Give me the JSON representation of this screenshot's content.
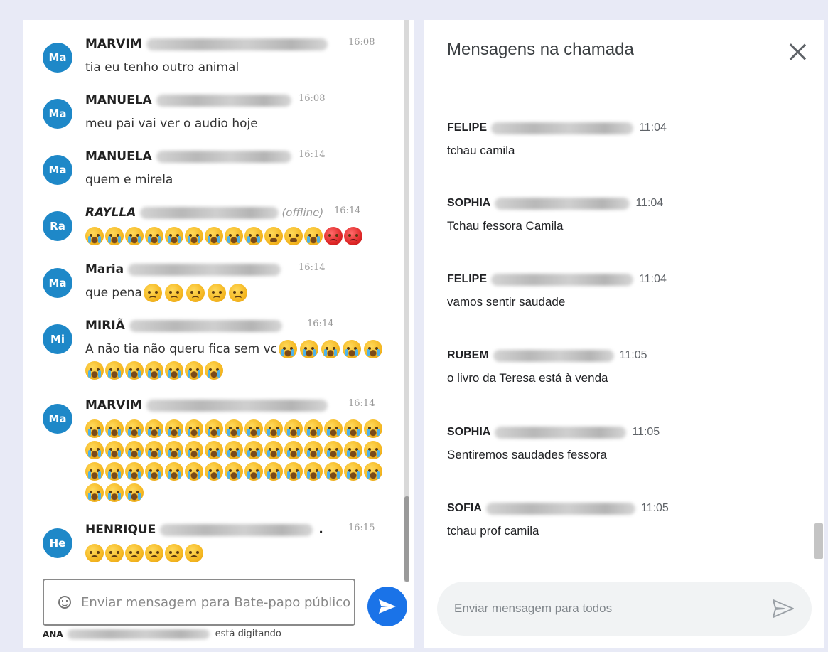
{
  "public_chat": {
    "messages": [
      {
        "initials": "Ma",
        "sender": "MARVIM",
        "time": "16:08",
        "text": "tia eu tenho outro animal",
        "emojis": []
      },
      {
        "initials": "Ma",
        "sender": "MANUELA",
        "time": "16:08",
        "text": "meu pai vai ver o audio hoje",
        "emojis": []
      },
      {
        "initials": "Ma",
        "sender": "MANUELA",
        "time": "16:14",
        "text": "quem e mirela",
        "emojis": []
      },
      {
        "initials": "Ra",
        "sender": "RAYLLA",
        "status": "(offline)",
        "time": "16:14",
        "text": "",
        "emojis": [
          "cry",
          "cry",
          "cry",
          "cry",
          "cry",
          "cry",
          "cry",
          "cry",
          "cry",
          "tired",
          "tired",
          "cry",
          "angry",
          "angry"
        ]
      },
      {
        "initials": "Ma",
        "sender": "Maria",
        "time": "16:14",
        "text": "que pena",
        "emojis": [
          "sad",
          "sad",
          "sad",
          "sad",
          "sad"
        ]
      },
      {
        "initials": "Mi",
        "sender": "MIRIÃ",
        "time": "16:14",
        "text": "A não tia não queru fica sem vc",
        "emojis": [
          "cry",
          "cry",
          "cry",
          "cry",
          "cry",
          "cry",
          "cry",
          "cry",
          "cry",
          "cry",
          "cry",
          "cry"
        ]
      },
      {
        "initials": "Ma",
        "sender": "MARVIM",
        "time": "16:14",
        "text": "",
        "emoji_count": 48
      },
      {
        "initials": "He",
        "sender": "HENRIQUE",
        "time": "16:15",
        "text": "",
        "emojis": [
          "worried",
          "worried",
          "worried",
          "worried",
          "worried",
          "worried"
        ]
      }
    ],
    "compose_placeholder": "Enviar mensagem para Bate-papo público",
    "typing_name": "ANA",
    "typing_label": "está digitando"
  },
  "meeting_chat": {
    "title": "Mensagens na chamada",
    "messages": [
      {
        "sender": "FELIPE",
        "time": "11:04",
        "text": "tchau camila"
      },
      {
        "sender": "SOPHIA",
        "time": "11:04",
        "text": "Tchau fessora Camila"
      },
      {
        "sender": "FELIPE",
        "time": "11:04",
        "text": "vamos sentir saudade"
      },
      {
        "sender": "RUBEM",
        "time": "11:05",
        "text": "o livro da Teresa está à venda"
      },
      {
        "sender": "SOPHIA",
        "time": "11:05",
        "text": "Sentiremos saudades fessora"
      },
      {
        "sender": "SOFIA",
        "time": "11:05",
        "text": "tchau prof camila"
      }
    ],
    "compose_placeholder": "Enviar mensagem para todos"
  },
  "colors": {
    "avatar": "#1e88c8",
    "send_button": "#1a73e8",
    "background": "#e8eaf6"
  }
}
